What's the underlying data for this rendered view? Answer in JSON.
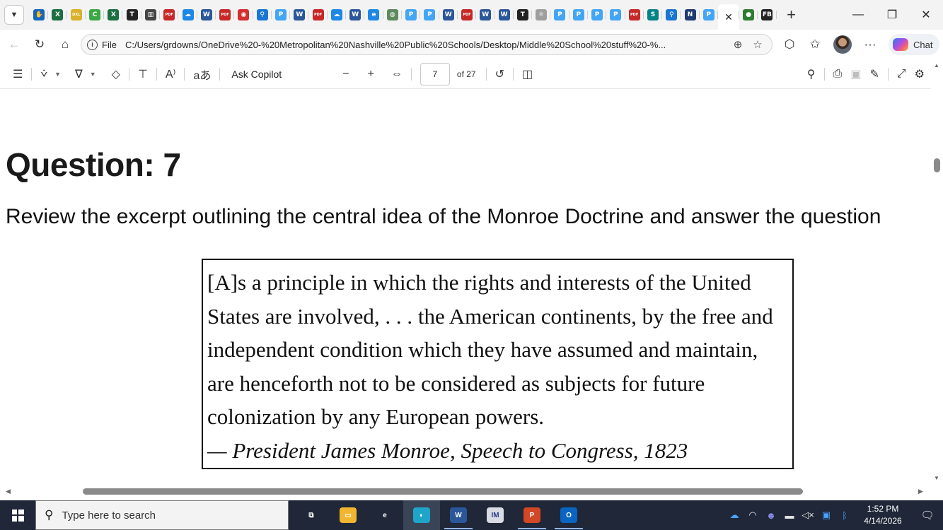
{
  "browser": {
    "tabs": [
      {
        "icon": "mouse-app-icon",
        "color": "#1565c0",
        "glyph": "✋"
      },
      {
        "icon": "excel-icon",
        "color": "#1d6f42",
        "glyph": "X"
      },
      {
        "icon": "dxl-icon",
        "color": "#d9b12a",
        "glyph": "DXL"
      },
      {
        "icon": "classlink-icon",
        "color": "#3aa845",
        "glyph": "C"
      },
      {
        "icon": "excel-icon",
        "color": "#1d6f42",
        "glyph": "X"
      },
      {
        "icon": "nyt-icon",
        "color": "#222222",
        "glyph": "T"
      },
      {
        "icon": "chart-doc-icon",
        "color": "#444444",
        "glyph": "▥"
      },
      {
        "icon": "pdf-icon",
        "color": "#c62828",
        "glyph": "PDF"
      },
      {
        "icon": "onedrive-icon",
        "color": "#1e88e5",
        "glyph": "☁"
      },
      {
        "icon": "word-icon",
        "color": "#2b579a",
        "glyph": "W"
      },
      {
        "icon": "pdf-icon",
        "color": "#c62828",
        "glyph": "PDF"
      },
      {
        "icon": "record-icon",
        "color": "#d32f2f",
        "glyph": "◉"
      },
      {
        "icon": "search-icon",
        "color": "#1976d2",
        "glyph": "⚲"
      },
      {
        "icon": "pearson-icon",
        "color": "#42a5f5",
        "glyph": "P"
      },
      {
        "icon": "word-icon",
        "color": "#2b579a",
        "glyph": "W"
      },
      {
        "icon": "pdf-icon",
        "color": "#c62828",
        "glyph": "PDF"
      },
      {
        "icon": "onedrive-icon",
        "color": "#1e88e5",
        "glyph": "☁"
      },
      {
        "icon": "word-icon",
        "color": "#2b579a",
        "glyph": "W"
      },
      {
        "icon": "internet-explorer-icon",
        "color": "#1e88e5",
        "glyph": "e"
      },
      {
        "icon": "globe-icon",
        "color": "#5d8a5e",
        "glyph": "◍"
      },
      {
        "icon": "pearson-icon",
        "color": "#42a5f5",
        "glyph": "P"
      },
      {
        "icon": "pearson-icon",
        "color": "#42a5f5",
        "glyph": "P"
      },
      {
        "icon": "word-icon",
        "color": "#2b579a",
        "glyph": "W"
      },
      {
        "icon": "pdf-icon",
        "color": "#c62828",
        "glyph": "PDF"
      },
      {
        "icon": "word-icon",
        "color": "#2b579a",
        "glyph": "W"
      },
      {
        "icon": "word-icon",
        "color": "#2b579a",
        "glyph": "W"
      },
      {
        "icon": "nyt-icon",
        "color": "#222222",
        "glyph": "T"
      },
      {
        "icon": "atom-icon",
        "color": "#9e9e9e",
        "glyph": "⚛"
      },
      {
        "icon": "pearson-icon",
        "color": "#42a5f5",
        "glyph": "P"
      },
      {
        "icon": "pearson-icon",
        "color": "#42a5f5",
        "glyph": "P"
      },
      {
        "icon": "pearson-icon",
        "color": "#42a5f5",
        "glyph": "P"
      },
      {
        "icon": "pearson-icon",
        "color": "#42a5f5",
        "glyph": "P"
      },
      {
        "icon": "pdf-icon",
        "color": "#c62828",
        "glyph": "PDF"
      },
      {
        "icon": "sharepoint-icon",
        "color": "#038387",
        "glyph": "S"
      },
      {
        "icon": "search-icon",
        "color": "#1976d2",
        "glyph": "⚲"
      },
      {
        "icon": "notion-icon",
        "color": "#1f3b73",
        "glyph": "N"
      },
      {
        "icon": "pearson-icon",
        "color": "#42a5f5",
        "glyph": "P"
      }
    ],
    "extra_tabs": [
      {
        "icon": "green-globe-icon",
        "color": "#2e7d32",
        "glyph": "●"
      },
      {
        "icon": "fb-icon",
        "color": "#222222",
        "glyph": "FB"
      }
    ],
    "active_tab_close": "✕",
    "new_tab": "+",
    "url_scheme": "File",
    "url": "C:/Users/grdowns/OneDrive%20-%20Metropolitan%20Nashville%20Public%20Schools/Desktop/Middle%20School%20stuff%20-%...",
    "chat_label": "Chat"
  },
  "pdf_toolbar": {
    "ask_copilot": "Ask Copilot",
    "current_page": "7",
    "total_pages": "of 27"
  },
  "document": {
    "question_title": "Question: 7",
    "prompt": "Review the excerpt outlining the central idea of the Monroe Doctrine and answer the question",
    "excerpt_lines": [
      "[A]s a principle in which the rights and interests of the United",
      "States are involved, . . . the American continents, by the free and",
      "independent condition which they have assumed and maintain,",
      "are henceforth not to be considered as subjects for future",
      "colonization by any European powers."
    ],
    "attribution": "— President James Monroe, Speech to Congress, 1823"
  },
  "taskbar": {
    "search_placeholder": "Type here to search",
    "time": "1:52 PM",
    "date": "4/14/2026",
    "apps": [
      {
        "name": "task-view-icon",
        "color": "#1f2738",
        "glyph": "⧉",
        "state": ""
      },
      {
        "name": "file-explorer-icon",
        "color": "#f2b530",
        "glyph": "▭",
        "state": ""
      },
      {
        "name": "internet-explorer-icon",
        "color": "#1f2738",
        "glyph": "e",
        "state": ""
      },
      {
        "name": "edge-icon",
        "color": "#1fa5c9",
        "glyph": "◐",
        "state": "active"
      },
      {
        "name": "word-icon",
        "color": "#2b579a",
        "glyph": "W",
        "state": "running"
      },
      {
        "name": "im-app-icon",
        "color": "#d8dbe3",
        "glyph": "IM",
        "state": ""
      },
      {
        "name": "powerpoint-icon",
        "color": "#d24726",
        "glyph": "P",
        "state": "running"
      },
      {
        "name": "outlook-icon",
        "color": "#0a64c2",
        "glyph": "O",
        "state": "running"
      }
    ]
  }
}
